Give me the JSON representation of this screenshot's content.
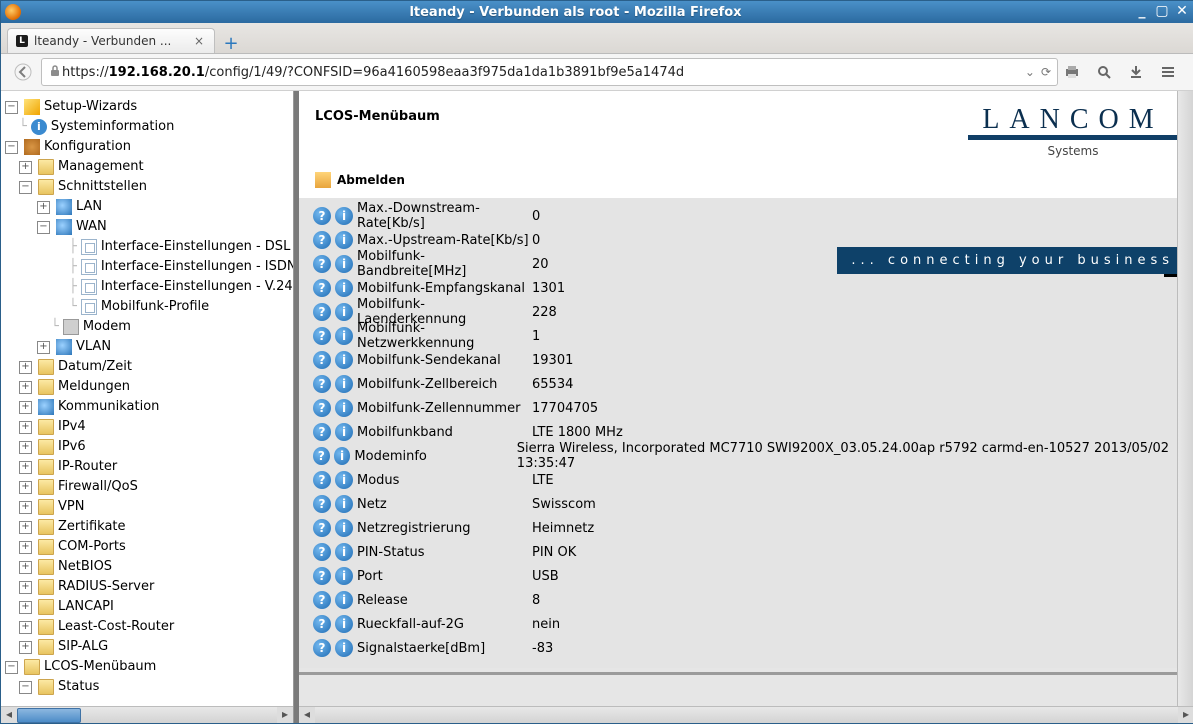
{
  "window_title": "lteandy - Verbunden als root - Mozilla Firefox",
  "tab": {
    "label": "lteandy - Verbunden ...",
    "favicon_letter": "L"
  },
  "url": {
    "scheme": "https://",
    "host": "192.168.20.1",
    "rest": "/config/1/49/?CONFSID=96a4160598eaa3f975da1da1b3891bf9e5a1474d"
  },
  "tree": {
    "n0": "Setup-Wizards",
    "n1": "Systeminformation",
    "n2": "Konfiguration",
    "n3": "Management",
    "n4": "Schnittstellen",
    "n5": "LAN",
    "n6": "WAN",
    "n7": "Interface-Einstellungen - DSL",
    "n8": "Interface-Einstellungen - ISDN",
    "n9": "Interface-Einstellungen - V.24",
    "n10": "Mobilfunk-Profile",
    "n11": "Modem",
    "n12": "VLAN",
    "n13": "Datum/Zeit",
    "n14": "Meldungen",
    "n15": "Kommunikation",
    "n16": "IPv4",
    "n17": "IPv6",
    "n18": "IP-Router",
    "n19": "Firewall/QoS",
    "n20": "VPN",
    "n21": "Zertifikate",
    "n22": "COM-Ports",
    "n23": "NetBIOS",
    "n24": "RADIUS-Server",
    "n25": "LANCAPI",
    "n26": "Least-Cost-Router",
    "n27": "SIP-ALG",
    "n28": "LCOS-Menübaum",
    "n29": "Status"
  },
  "page_title": "LCOS-Menübaum",
  "logout_label": "Abmelden",
  "brand": {
    "name": "LANCOM",
    "sub": "Systems",
    "strap": "...  connecting  your  business"
  },
  "rows": [
    {
      "k": "Max.-Downstream-Rate[Kb/s]",
      "v": "0"
    },
    {
      "k": "Max.-Upstream-Rate[Kb/s]",
      "v": "0"
    },
    {
      "k": "Mobilfunk-Bandbreite[MHz]",
      "v": "20"
    },
    {
      "k": "Mobilfunk-Empfangskanal",
      "v": "1301"
    },
    {
      "k": "Mobilfunk-Laenderkennung",
      "v": "228"
    },
    {
      "k": "Mobilfunk-Netzwerkkennung",
      "v": "1"
    },
    {
      "k": "Mobilfunk-Sendekanal",
      "v": "19301"
    },
    {
      "k": "Mobilfunk-Zellbereich",
      "v": "65534"
    },
    {
      "k": "Mobilfunk-Zellennummer",
      "v": "17704705"
    },
    {
      "k": "Mobilfunkband",
      "v": "LTE 1800 MHz"
    },
    {
      "k": "Modeminfo",
      "v": "Sierra Wireless, Incorporated MC7710 SWI9200X_03.05.24.00ap r5792 carmd-en-10527 2013/05/02 13:35:47"
    },
    {
      "k": "Modus",
      "v": "LTE"
    },
    {
      "k": "Netz",
      "v": "Swisscom"
    },
    {
      "k": "Netzregistrierung",
      "v": "Heimnetz"
    },
    {
      "k": "PIN-Status",
      "v": "PIN OK"
    },
    {
      "k": "Port",
      "v": "USB"
    },
    {
      "k": "Release",
      "v": "8"
    },
    {
      "k": "Rueckfall-auf-2G",
      "v": "nein"
    },
    {
      "k": "Signalstaerke[dBm]",
      "v": "-83"
    }
  ]
}
